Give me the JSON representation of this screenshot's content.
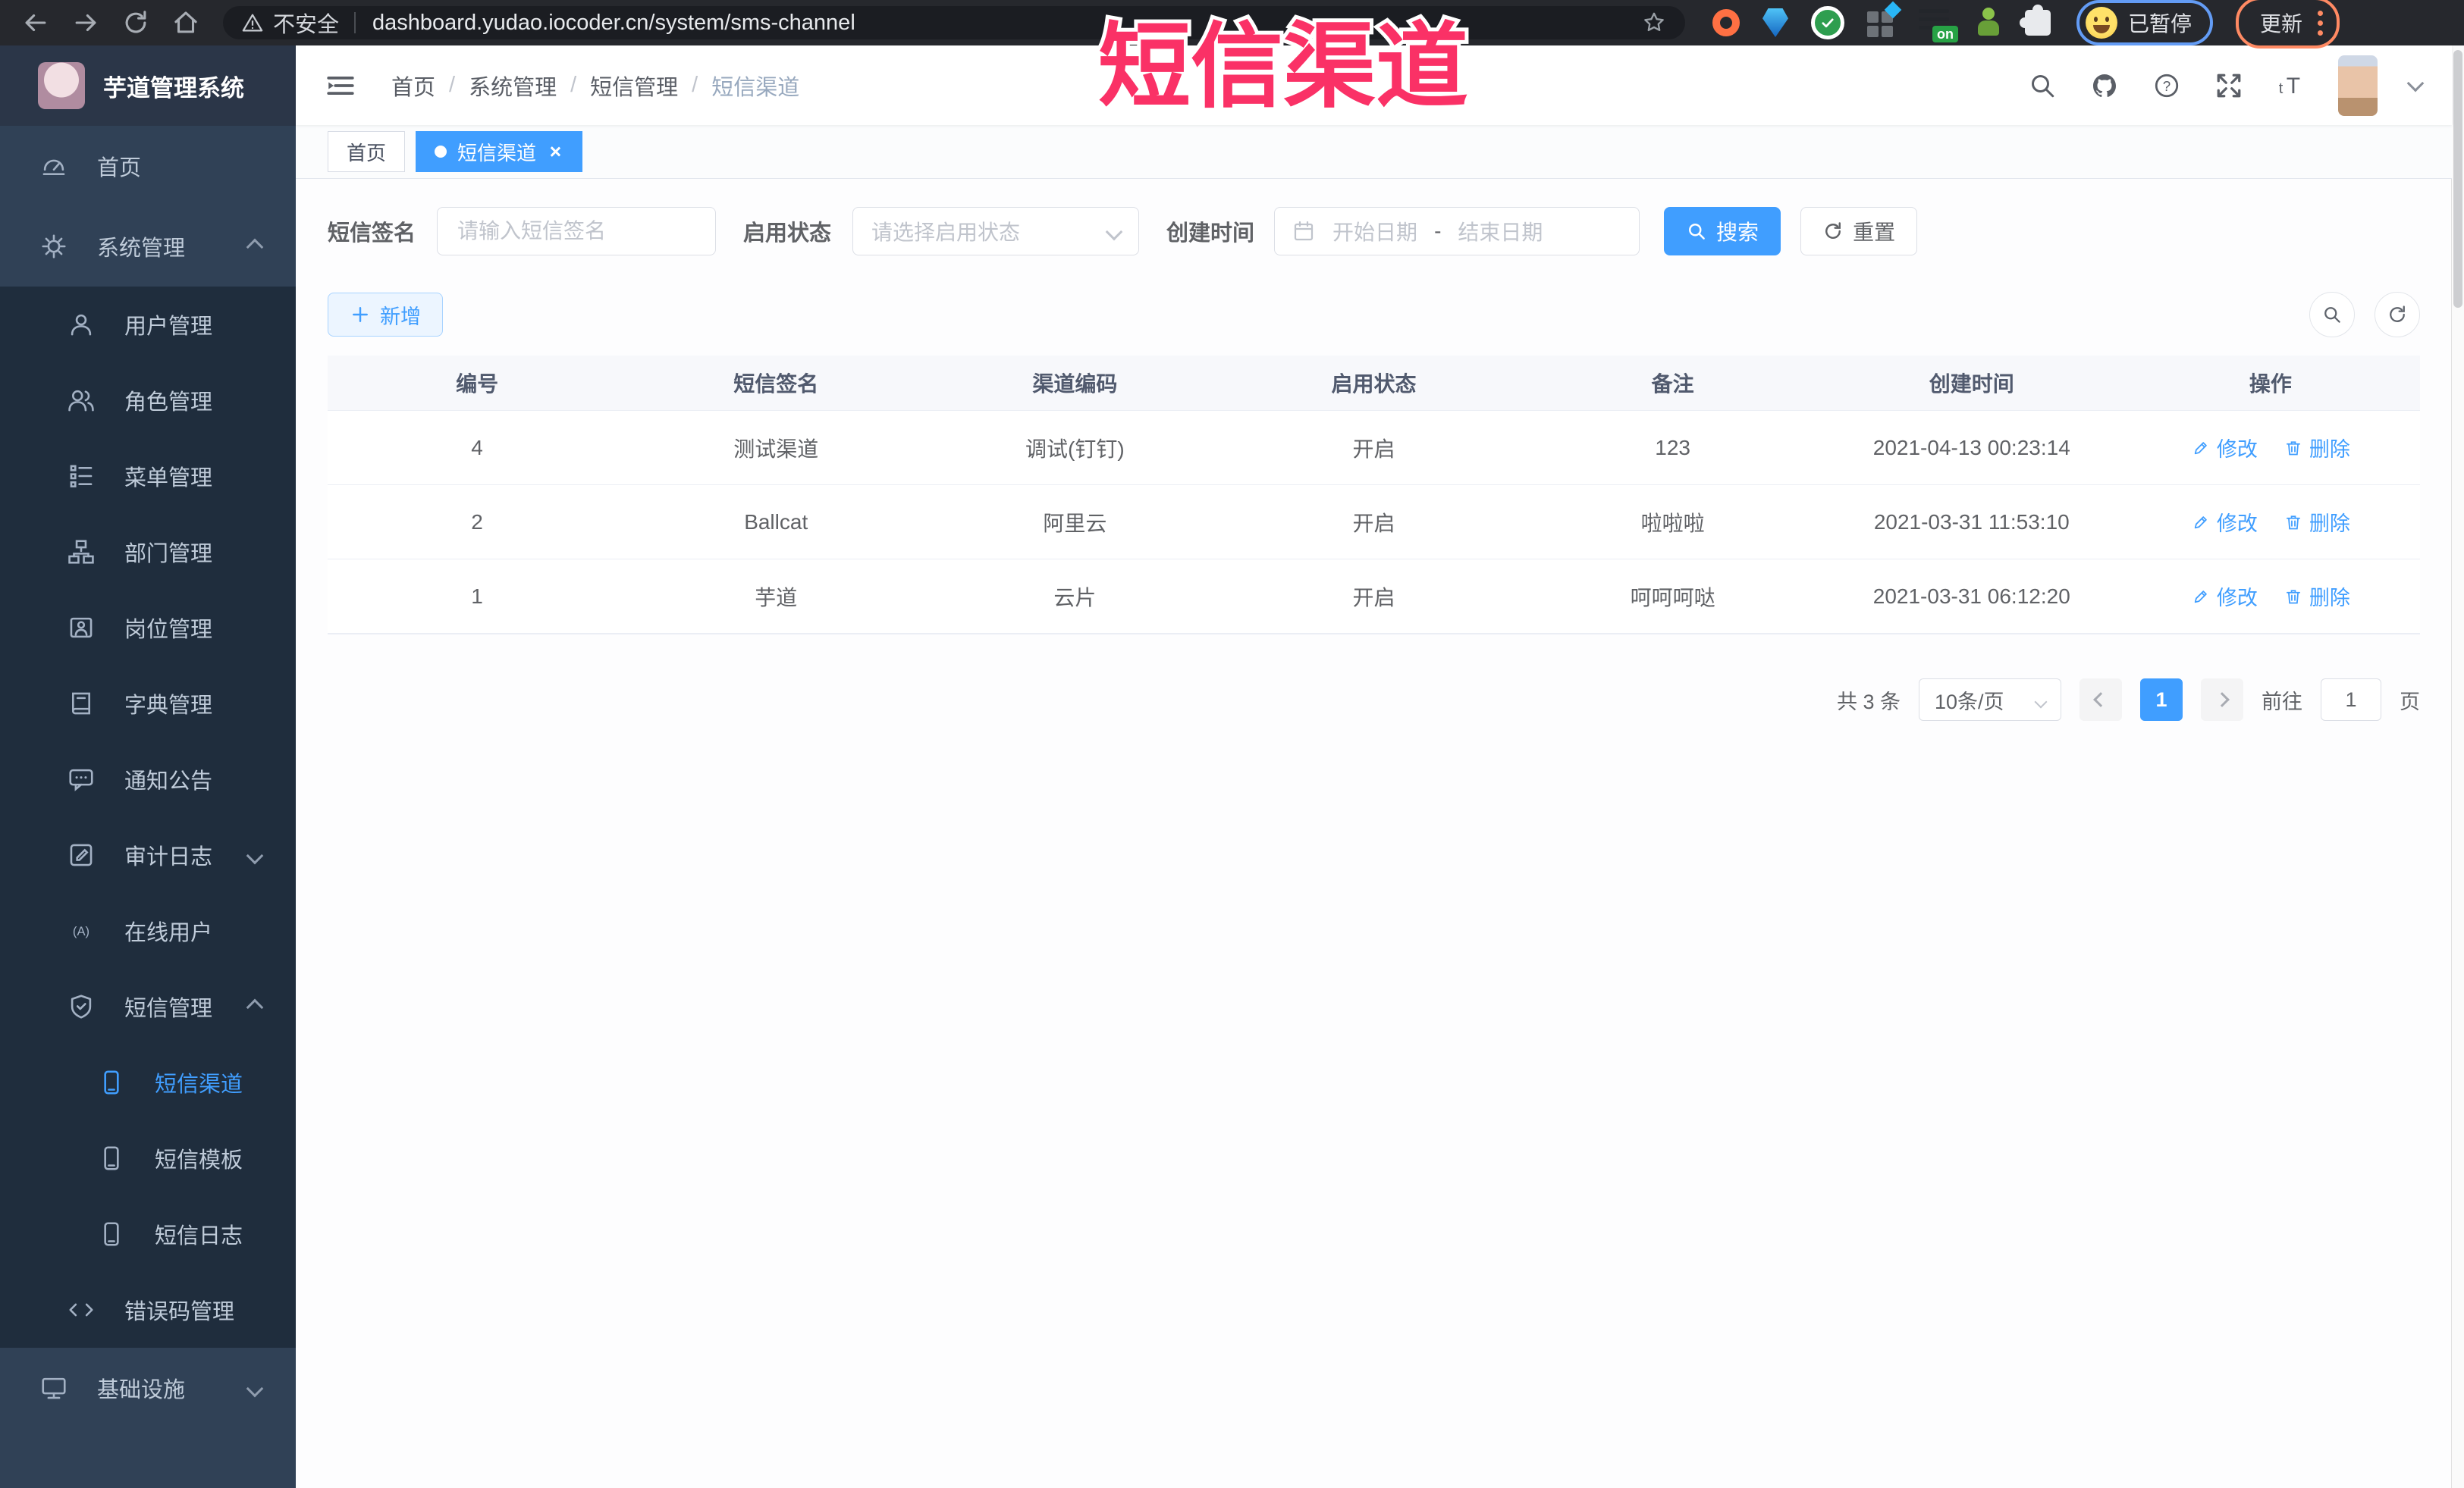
{
  "watermark": {
    "text": "短信渠道",
    "color": "#fa3166"
  },
  "browser": {
    "security_label": "不安全",
    "url": "dashboard.yudao.iocoder.cn/system/sms-channel",
    "extension_badge": "on",
    "profile_label": "已暂停",
    "update_label": "更新"
  },
  "sidebar": {
    "logo_title": "芋道管理系统",
    "items": [
      {
        "label": "首页"
      },
      {
        "label": "系统管理"
      },
      {
        "label": "用户管理"
      },
      {
        "label": "角色管理"
      },
      {
        "label": "菜单管理"
      },
      {
        "label": "部门管理"
      },
      {
        "label": "岗位管理"
      },
      {
        "label": "字典管理"
      },
      {
        "label": "通知公告"
      },
      {
        "label": "审计日志"
      },
      {
        "label": "在线用户"
      },
      {
        "label": "短信管理"
      },
      {
        "label": "短信渠道"
      },
      {
        "label": "短信模板"
      },
      {
        "label": "短信日志"
      },
      {
        "label": "错误码管理"
      },
      {
        "label": "基础设施"
      }
    ]
  },
  "header": {
    "breadcrumb": [
      "首页",
      "系统管理",
      "短信管理",
      "短信渠道"
    ],
    "separator": "/"
  },
  "tabs": [
    {
      "label": "首页"
    },
    {
      "label": "短信渠道"
    }
  ],
  "filters": {
    "signature_label": "短信签名",
    "signature_placeholder": "请输入短信签名",
    "status_label": "启用状态",
    "status_placeholder": "请选择启用状态",
    "time_label": "创建时间",
    "start_placeholder": "开始日期",
    "range_separator": "-",
    "end_placeholder": "结束日期",
    "search_label": "搜索",
    "reset_label": "重置"
  },
  "toolbar": {
    "add_label": "新增"
  },
  "table": {
    "headers": [
      "编号",
      "短信签名",
      "渠道编码",
      "启用状态",
      "备注",
      "创建时间",
      "操作"
    ],
    "edit_label": "修改",
    "delete_label": "删除",
    "rows": [
      {
        "id": "4",
        "signature": "测试渠道",
        "code": "调试(钉钉)",
        "status": "开启",
        "remark": "123",
        "created": "2021-04-13 00:23:14"
      },
      {
        "id": "2",
        "signature": "Ballcat",
        "code": "阿里云",
        "status": "开启",
        "remark": "啦啦啦",
        "created": "2021-03-31 11:53:10"
      },
      {
        "id": "1",
        "signature": "芋道",
        "code": "云片",
        "status": "开启",
        "remark": "呵呵呵哒",
        "created": "2021-03-31 06:12:20"
      }
    ]
  },
  "pagination": {
    "total": "共 3 条",
    "page_size": "10条/页",
    "current": "1",
    "goto_label": "前往",
    "goto_value": "1",
    "unit_label": "页"
  },
  "colors": {
    "accent": "#409eff"
  }
}
